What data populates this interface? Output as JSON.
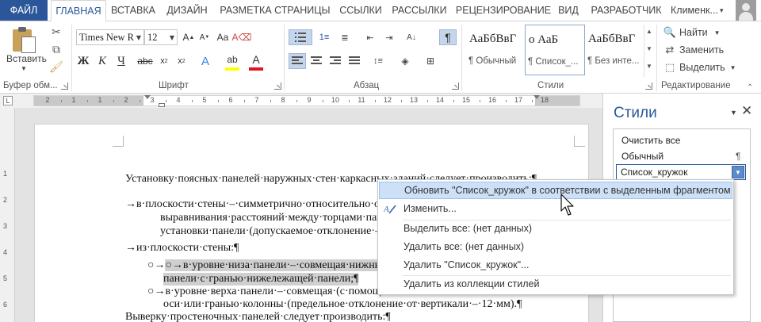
{
  "tabs": {
    "file": "ФАЙЛ",
    "items": [
      "ГЛАВНАЯ",
      "ВСТАВКА",
      "ДИЗАЙН",
      "РАЗМЕТКА СТРАНИЦЫ",
      "ССЫЛКИ",
      "РАССЫЛКИ",
      "РЕЦЕНЗИРОВАНИЕ",
      "ВИД",
      "РАЗРАБОТЧИК"
    ],
    "active": "ГЛАВНАЯ",
    "user": "Клименк..."
  },
  "ribbon": {
    "clipboard": {
      "label": "Буфер обм...",
      "paste": "Вставить"
    },
    "font": {
      "label": "Шрифт",
      "family": "Times New R",
      "size": "12"
    },
    "paragraph": {
      "label": "Абзац"
    },
    "styles": {
      "label": "Стили",
      "tiles": [
        {
          "sample": "АаБбВвГ",
          "name": "¶ Обычный"
        },
        {
          "sample": "о     АаБ",
          "name": "¶ Список_..."
        },
        {
          "sample": "АаБбВвГ",
          "name": "¶ Без инте..."
        }
      ]
    },
    "editing": {
      "label": "Редактирование",
      "find": "Найти",
      "replace": "Заменить",
      "select": "Выделить"
    }
  },
  "ruler": {
    "numbers": [
      "2",
      "1",
      "1",
      "2",
      "3",
      "4",
      "5",
      "6",
      "7",
      "8",
      "9",
      "10",
      "11",
      "12",
      "13",
      "14",
      "15",
      "16",
      "17",
      "18"
    ],
    "corner_glyph": "L"
  },
  "vruler": {
    "numbers": [
      "1",
      "2",
      "3",
      "4",
      "5",
      "6",
      "7",
      "8"
    ]
  },
  "document": {
    "lines": [
      "Установку·поясных·панелей·наружных·стен·каркасных·зданий·следует·производить:¶",
      "→в·плоскости·стены·–·симметрично·относительно·ос",
      "выравнивания·расстояний·между·торцами·панели",
      "установки·панели·(допускаемое·отклонение·–·10·м",
      "→из·плоскости·стены:¶",
      "○→в·уровне·низа·панели·–·совмещая·нижнюю·вн",
      "панели·с·гранью·нижележащей·панели;¶",
      "○→в·уровне·верха·панели·–·совмещая·(с·помощью",
      "оси·или·гранью·колонны·(предельное·отклонение·от·вертикали·–·12·мм).¶",
      "Выверку·простеночных·панелей·следует·производить:¶"
    ]
  },
  "styles_pane": {
    "title": "Стили",
    "items": [
      "Очистить все",
      "Обычный",
      "Список_кружок"
    ],
    "pilcrow": "¶"
  },
  "context_menu": {
    "items": [
      {
        "label": "Обновить \"Список_кружок\" в соответствии с выделенным фрагментом",
        "icon": ""
      },
      {
        "label": "Изменить...",
        "icon": "edit-style-icon"
      },
      {
        "label": "Выделить все: (нет данных)",
        "icon": ""
      },
      {
        "label": "Удалить все: (нет данных)",
        "icon": ""
      },
      {
        "label": "Удалить \"Список_кружок\"...",
        "icon": ""
      },
      {
        "label": "Удалить из коллекции стилей",
        "icon": ""
      }
    ]
  },
  "colors": {
    "accent": "#2b579a",
    "menu_hover": "#cde0f7",
    "selection": "#cfcfcf",
    "highlight_yellow": "#ffff00",
    "font_color_red": "#e81123"
  }
}
